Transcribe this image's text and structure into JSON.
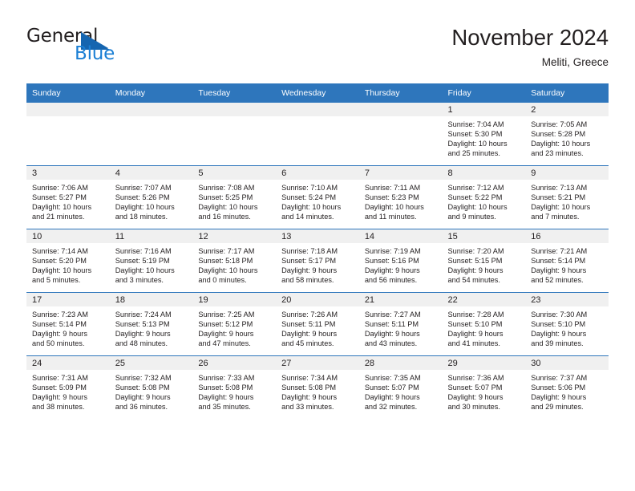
{
  "brand": {
    "name_part1": "General",
    "name_part2": "Blue",
    "triangle_color": "#1565b0",
    "blue": "#1b7fd4"
  },
  "header": {
    "title": "November 2024",
    "subtitle": "Meliti, Greece"
  },
  "theme": {
    "header_bg": "#2e76bc",
    "header_text": "#ffffff",
    "daynum_bg": "#f0f0f0",
    "cell_bg": "#ffffff",
    "text": "#231f20"
  },
  "weekday_headers": [
    "Sunday",
    "Monday",
    "Tuesday",
    "Wednesday",
    "Thursday",
    "Friday",
    "Saturday"
  ],
  "labels": {
    "sunrise": "Sunrise:",
    "sunset": "Sunset:",
    "daylight": "Daylight:"
  },
  "weeks": [
    [
      {
        "day": ""
      },
      {
        "day": ""
      },
      {
        "day": ""
      },
      {
        "day": ""
      },
      {
        "day": ""
      },
      {
        "day": "1",
        "sunrise": "Sunrise: 7:04 AM",
        "sunset": "Sunset: 5:30 PM",
        "daylight_line1": "Daylight: 10 hours",
        "daylight_line2": "and 25 minutes."
      },
      {
        "day": "2",
        "sunrise": "Sunrise: 7:05 AM",
        "sunset": "Sunset: 5:28 PM",
        "daylight_line1": "Daylight: 10 hours",
        "daylight_line2": "and 23 minutes."
      }
    ],
    [
      {
        "day": "3",
        "sunrise": "Sunrise: 7:06 AM",
        "sunset": "Sunset: 5:27 PM",
        "daylight_line1": "Daylight: 10 hours",
        "daylight_line2": "and 21 minutes."
      },
      {
        "day": "4",
        "sunrise": "Sunrise: 7:07 AM",
        "sunset": "Sunset: 5:26 PM",
        "daylight_line1": "Daylight: 10 hours",
        "daylight_line2": "and 18 minutes."
      },
      {
        "day": "5",
        "sunrise": "Sunrise: 7:08 AM",
        "sunset": "Sunset: 5:25 PM",
        "daylight_line1": "Daylight: 10 hours",
        "daylight_line2": "and 16 minutes."
      },
      {
        "day": "6",
        "sunrise": "Sunrise: 7:10 AM",
        "sunset": "Sunset: 5:24 PM",
        "daylight_line1": "Daylight: 10 hours",
        "daylight_line2": "and 14 minutes."
      },
      {
        "day": "7",
        "sunrise": "Sunrise: 7:11 AM",
        "sunset": "Sunset: 5:23 PM",
        "daylight_line1": "Daylight: 10 hours",
        "daylight_line2": "and 11 minutes."
      },
      {
        "day": "8",
        "sunrise": "Sunrise: 7:12 AM",
        "sunset": "Sunset: 5:22 PM",
        "daylight_line1": "Daylight: 10 hours",
        "daylight_line2": "and 9 minutes."
      },
      {
        "day": "9",
        "sunrise": "Sunrise: 7:13 AM",
        "sunset": "Sunset: 5:21 PM",
        "daylight_line1": "Daylight: 10 hours",
        "daylight_line2": "and 7 minutes."
      }
    ],
    [
      {
        "day": "10",
        "sunrise": "Sunrise: 7:14 AM",
        "sunset": "Sunset: 5:20 PM",
        "daylight_line1": "Daylight: 10 hours",
        "daylight_line2": "and 5 minutes."
      },
      {
        "day": "11",
        "sunrise": "Sunrise: 7:16 AM",
        "sunset": "Sunset: 5:19 PM",
        "daylight_line1": "Daylight: 10 hours",
        "daylight_line2": "and 3 minutes."
      },
      {
        "day": "12",
        "sunrise": "Sunrise: 7:17 AM",
        "sunset": "Sunset: 5:18 PM",
        "daylight_line1": "Daylight: 10 hours",
        "daylight_line2": "and 0 minutes."
      },
      {
        "day": "13",
        "sunrise": "Sunrise: 7:18 AM",
        "sunset": "Sunset: 5:17 PM",
        "daylight_line1": "Daylight: 9 hours",
        "daylight_line2": "and 58 minutes."
      },
      {
        "day": "14",
        "sunrise": "Sunrise: 7:19 AM",
        "sunset": "Sunset: 5:16 PM",
        "daylight_line1": "Daylight: 9 hours",
        "daylight_line2": "and 56 minutes."
      },
      {
        "day": "15",
        "sunrise": "Sunrise: 7:20 AM",
        "sunset": "Sunset: 5:15 PM",
        "daylight_line1": "Daylight: 9 hours",
        "daylight_line2": "and 54 minutes."
      },
      {
        "day": "16",
        "sunrise": "Sunrise: 7:21 AM",
        "sunset": "Sunset: 5:14 PM",
        "daylight_line1": "Daylight: 9 hours",
        "daylight_line2": "and 52 minutes."
      }
    ],
    [
      {
        "day": "17",
        "sunrise": "Sunrise: 7:23 AM",
        "sunset": "Sunset: 5:14 PM",
        "daylight_line1": "Daylight: 9 hours",
        "daylight_line2": "and 50 minutes."
      },
      {
        "day": "18",
        "sunrise": "Sunrise: 7:24 AM",
        "sunset": "Sunset: 5:13 PM",
        "daylight_line1": "Daylight: 9 hours",
        "daylight_line2": "and 48 minutes."
      },
      {
        "day": "19",
        "sunrise": "Sunrise: 7:25 AM",
        "sunset": "Sunset: 5:12 PM",
        "daylight_line1": "Daylight: 9 hours",
        "daylight_line2": "and 47 minutes."
      },
      {
        "day": "20",
        "sunrise": "Sunrise: 7:26 AM",
        "sunset": "Sunset: 5:11 PM",
        "daylight_line1": "Daylight: 9 hours",
        "daylight_line2": "and 45 minutes."
      },
      {
        "day": "21",
        "sunrise": "Sunrise: 7:27 AM",
        "sunset": "Sunset: 5:11 PM",
        "daylight_line1": "Daylight: 9 hours",
        "daylight_line2": "and 43 minutes."
      },
      {
        "day": "22",
        "sunrise": "Sunrise: 7:28 AM",
        "sunset": "Sunset: 5:10 PM",
        "daylight_line1": "Daylight: 9 hours",
        "daylight_line2": "and 41 minutes."
      },
      {
        "day": "23",
        "sunrise": "Sunrise: 7:30 AM",
        "sunset": "Sunset: 5:10 PM",
        "daylight_line1": "Daylight: 9 hours",
        "daylight_line2": "and 39 minutes."
      }
    ],
    [
      {
        "day": "24",
        "sunrise": "Sunrise: 7:31 AM",
        "sunset": "Sunset: 5:09 PM",
        "daylight_line1": "Daylight: 9 hours",
        "daylight_line2": "and 38 minutes."
      },
      {
        "day": "25",
        "sunrise": "Sunrise: 7:32 AM",
        "sunset": "Sunset: 5:08 PM",
        "daylight_line1": "Daylight: 9 hours",
        "daylight_line2": "and 36 minutes."
      },
      {
        "day": "26",
        "sunrise": "Sunrise: 7:33 AM",
        "sunset": "Sunset: 5:08 PM",
        "daylight_line1": "Daylight: 9 hours",
        "daylight_line2": "and 35 minutes."
      },
      {
        "day": "27",
        "sunrise": "Sunrise: 7:34 AM",
        "sunset": "Sunset: 5:08 PM",
        "daylight_line1": "Daylight: 9 hours",
        "daylight_line2": "and 33 minutes."
      },
      {
        "day": "28",
        "sunrise": "Sunrise: 7:35 AM",
        "sunset": "Sunset: 5:07 PM",
        "daylight_line1": "Daylight: 9 hours",
        "daylight_line2": "and 32 minutes."
      },
      {
        "day": "29",
        "sunrise": "Sunrise: 7:36 AM",
        "sunset": "Sunset: 5:07 PM",
        "daylight_line1": "Daylight: 9 hours",
        "daylight_line2": "and 30 minutes."
      },
      {
        "day": "30",
        "sunrise": "Sunrise: 7:37 AM",
        "sunset": "Sunset: 5:06 PM",
        "daylight_line1": "Daylight: 9 hours",
        "daylight_line2": "and 29 minutes."
      }
    ]
  ]
}
